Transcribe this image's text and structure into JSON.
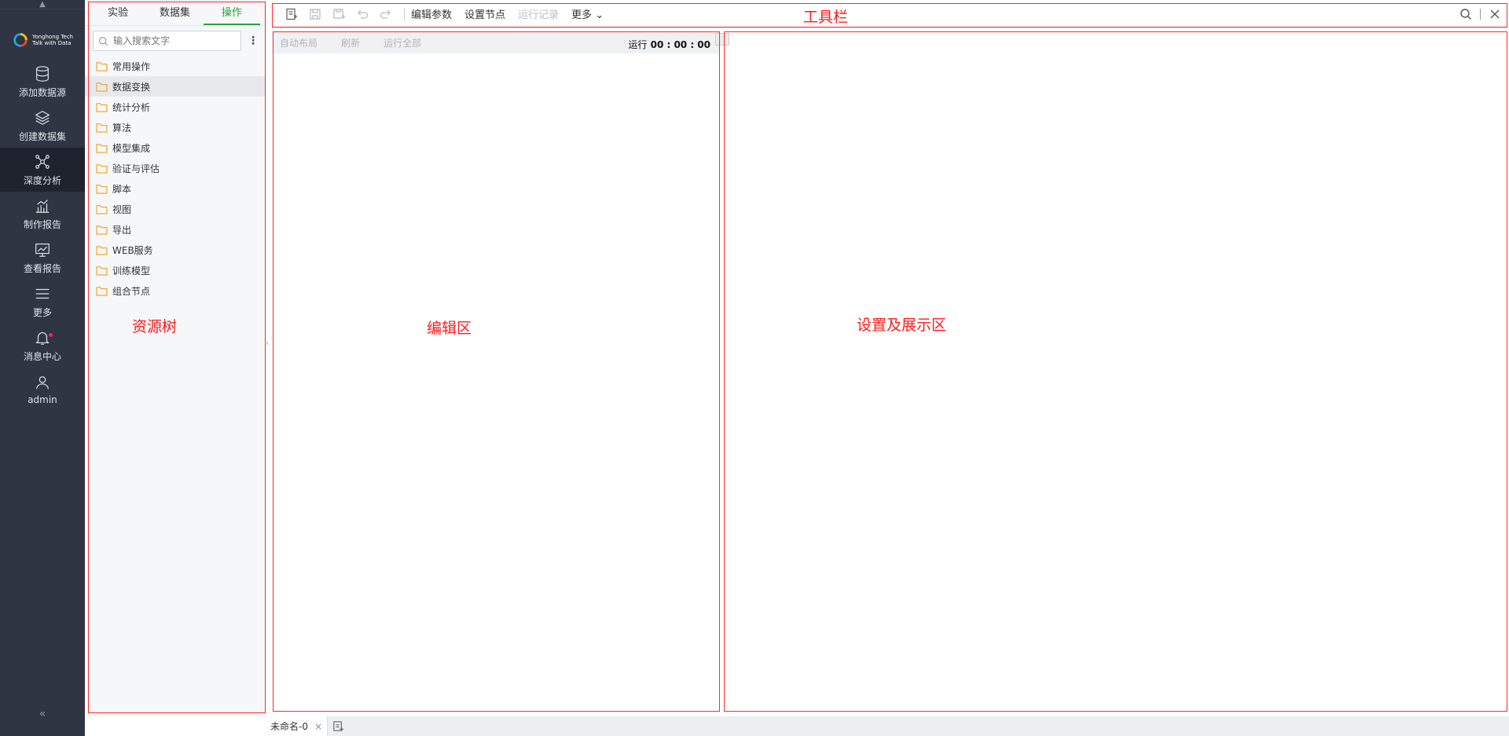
{
  "nav": {
    "logo": {
      "line1": "Yonghong Tech",
      "line2": "Talk with Data"
    },
    "items": [
      {
        "label": "添加数据源",
        "icon": "database-icon"
      },
      {
        "label": "创建数据集",
        "icon": "layers-icon"
      },
      {
        "label": "深度分析",
        "icon": "network-icon",
        "active": true
      },
      {
        "label": "制作报告",
        "icon": "bar-chart-icon"
      },
      {
        "label": "查看报告",
        "icon": "monitor-chart-icon"
      },
      {
        "label": "更多",
        "icon": "menu-icon"
      },
      {
        "label": "消息中心",
        "icon": "bell-icon"
      },
      {
        "label": "admin",
        "icon": "user-icon"
      }
    ],
    "collapse": "«"
  },
  "resource": {
    "tabs": [
      "实验",
      "数据集",
      "操作"
    ],
    "active_tab": 2,
    "search_placeholder": "输入搜索文字",
    "tree": [
      "常用操作",
      "数据变换",
      "统计分析",
      "算法",
      "模型集成",
      "验证与评估",
      "脚本",
      "视图",
      "导出",
      "WEB服务",
      "训练模型",
      "组合节点"
    ],
    "selected_index": 1
  },
  "toolbar": {
    "edit_params": "编辑参数",
    "set_node": "设置节点",
    "run_log": "运行记录",
    "more": "更多"
  },
  "edit": {
    "auto_layout": "自动布局",
    "refresh": "刷新",
    "run_all": "运行全部",
    "run_label": "运行",
    "run_time": "00 : 00 : 00"
  },
  "annotations": {
    "toolbar": "工具栏",
    "resource_tree": "资源树",
    "edit_area": "编辑区",
    "settings_area": "设置及展示区"
  },
  "bottom": {
    "tab_name": "未命名-0",
    "close": "×"
  },
  "colors": {
    "accent": "#2aa23a",
    "annotation": "#ff1a1a",
    "nav_bg": "#2f3542",
    "folder": "#f0a020"
  }
}
